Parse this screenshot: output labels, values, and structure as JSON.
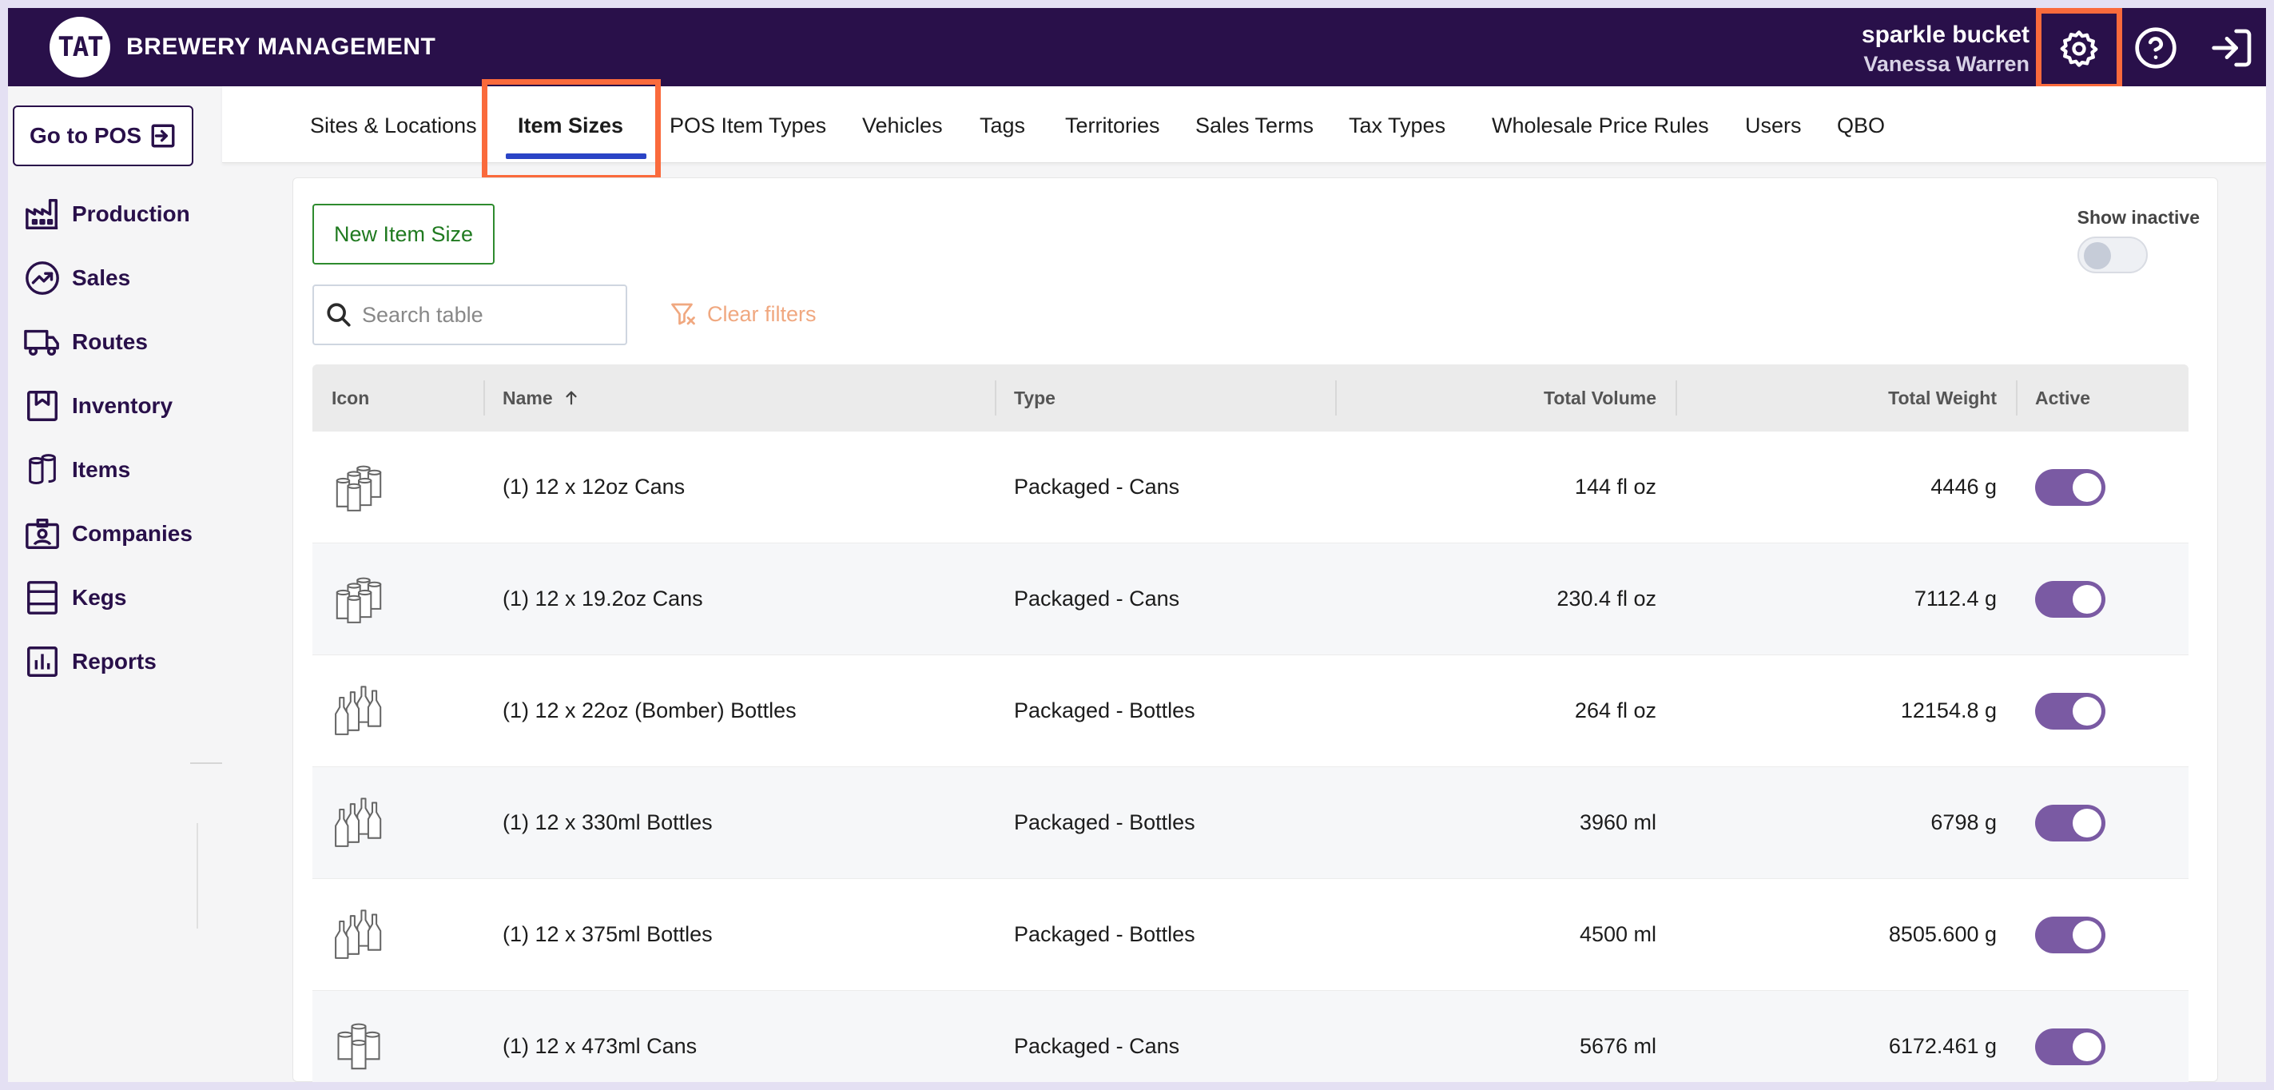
{
  "app": {
    "logo_text": "TAT",
    "title": "BREWERY MANAGEMENT",
    "org_name": "sparkle bucket",
    "user_name": "Vanessa Warren",
    "icons": {
      "settings": "gear-icon",
      "help": "help-circle-icon",
      "logout": "logout-icon"
    },
    "accent_color": "#29104a",
    "highlight_color": "#fa6a3c"
  },
  "sidebar": {
    "pos_button": "Go to POS",
    "items": [
      {
        "label": "Production",
        "icon": "factory-icon"
      },
      {
        "label": "Sales",
        "icon": "trend-icon"
      },
      {
        "label": "Routes",
        "icon": "truck-icon"
      },
      {
        "label": "Inventory",
        "icon": "inventory-icon"
      },
      {
        "label": "Items",
        "icon": "cans-icon"
      },
      {
        "label": "Companies",
        "icon": "badge-icon"
      },
      {
        "label": "Kegs",
        "icon": "keg-icon"
      },
      {
        "label": "Reports",
        "icon": "bar-chart-icon"
      }
    ]
  },
  "tabs": [
    {
      "label": "Sites & Locations"
    },
    {
      "label": "Item Sizes",
      "active": true
    },
    {
      "label": "POS Item Types"
    },
    {
      "label": "Vehicles"
    },
    {
      "label": "Tags"
    },
    {
      "label": "Territories"
    },
    {
      "label": "Sales Terms"
    },
    {
      "label": "Tax Types"
    },
    {
      "label": "Wholesale Price Rules"
    },
    {
      "label": "Users"
    },
    {
      "label": "QBO"
    }
  ],
  "toolbar": {
    "new_button": "New Item Size",
    "search_placeholder": "Search table",
    "clear_filters": "Clear filters",
    "show_inactive": "Show inactive",
    "show_inactive_on": false
  },
  "table": {
    "columns": {
      "icon": "Icon",
      "name": "Name",
      "type": "Type",
      "total_volume": "Total Volume",
      "total_weight": "Total Weight",
      "active": "Active"
    },
    "sort": {
      "column": "name",
      "direction": "asc"
    },
    "rows": [
      {
        "icon": "cans-icon",
        "name": "(1) 12 x 12oz Cans",
        "type": "Packaged - Cans",
        "total_volume": "144 fl oz",
        "total_weight": "4446 g",
        "active": true
      },
      {
        "icon": "cans-icon",
        "name": "(1) 12 x 19.2oz Cans",
        "type": "Packaged - Cans",
        "total_volume": "230.4 fl oz",
        "total_weight": "7112.4 g",
        "active": true
      },
      {
        "icon": "bottles-icon",
        "name": "(1) 12 x 22oz (Bomber) Bottles",
        "type": "Packaged - Bottles",
        "total_volume": "264 fl oz",
        "total_weight": "12154.8 g",
        "active": true
      },
      {
        "icon": "bottles-icon",
        "name": "(1) 12 x 330ml Bottles",
        "type": "Packaged - Bottles",
        "total_volume": "3960 ml",
        "total_weight": "6798 g",
        "active": true
      },
      {
        "icon": "bottles-icon",
        "name": "(1) 12 x 375ml Bottles",
        "type": "Packaged - Bottles",
        "total_volume": "4500 ml",
        "total_weight": "8505.600 g",
        "active": true
      },
      {
        "icon": "cans-icon",
        "name": "(1) 12 x 473ml Cans",
        "type": "Packaged - Cans",
        "total_volume": "5676 ml",
        "total_weight": "6172.461 g",
        "active": true
      }
    ]
  }
}
